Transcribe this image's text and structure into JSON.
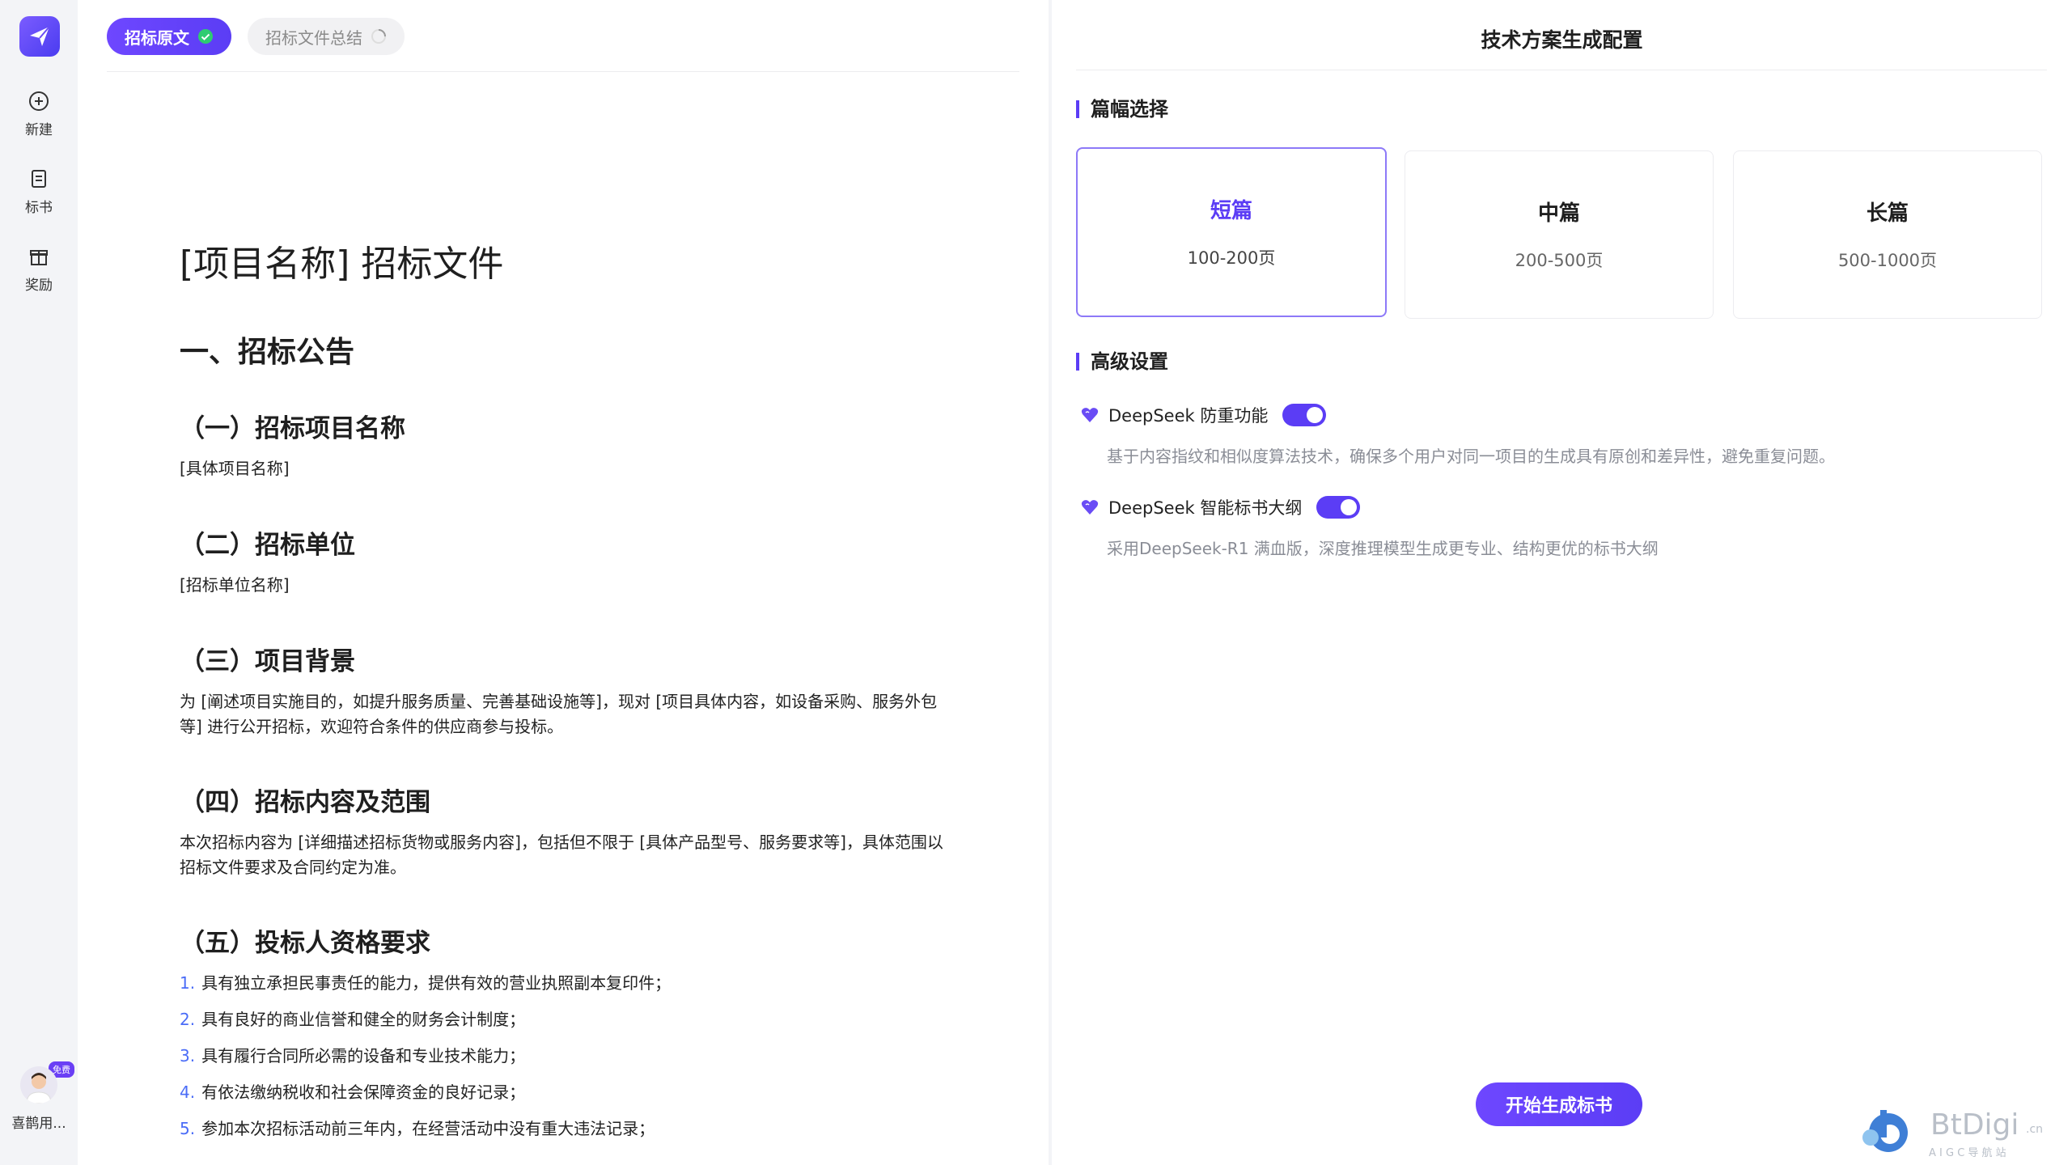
{
  "sidebar": {
    "items": [
      {
        "label": "新建",
        "icon": "plus-circle-icon"
      },
      {
        "label": "标书",
        "icon": "document-icon"
      },
      {
        "label": "奖励",
        "icon": "gift-icon"
      }
    ],
    "user": {
      "badge": "免费",
      "name": "喜鹊用..."
    }
  },
  "tabs": [
    {
      "label": "招标原文",
      "status": "done"
    },
    {
      "label": "招标文件总结",
      "status": "loading"
    }
  ],
  "document": {
    "title": "[项目名称] 招标文件",
    "section1": "一、招标公告",
    "s1": {
      "heading": "（一）招标项目名称",
      "body": "[具体项目名称]"
    },
    "s2": {
      "heading": "（二）招标单位",
      "body": "[招标单位名称]"
    },
    "s3": {
      "heading": "（三）项目背景",
      "body": "为 [阐述项目实施目的，如提升服务质量、完善基础设施等]，现对 [项目具体内容，如设备采购、服务外包等] 进行公开招标，欢迎符合条件的供应商参与投标。"
    },
    "s4": {
      "heading": "（四）招标内容及范围",
      "body": "本次招标内容为 [详细描述招标货物或服务内容]，包括但不限于 [具体产品型号、服务要求等]，具体范围以招标文件要求及合同约定为准。"
    },
    "s5": {
      "heading": "（五）投标人资格要求",
      "items": [
        {
          "num": "1.",
          "text": "具有独立承担民事责任的能力，提供有效的营业执照副本复印件；"
        },
        {
          "num": "2.",
          "text": "具有良好的商业信誉和健全的财务会计制度；"
        },
        {
          "num": "3.",
          "text": "具有履行合同所必需的设备和专业技术能力；"
        },
        {
          "num": "4.",
          "text": "有依法缴纳税收和社会保障资金的良好记录；"
        },
        {
          "num": "5.",
          "text": "参加本次招标活动前三年内，在经营活动中没有重大违法记录；"
        }
      ]
    }
  },
  "config": {
    "title": "技术方案生成配置",
    "length_section": "篇幅选择",
    "lengths": [
      {
        "title": "短篇",
        "range": "100-200页",
        "selected": true
      },
      {
        "title": "中篇",
        "range": "200-500页",
        "selected": false
      },
      {
        "title": "长篇",
        "range": "500-1000页",
        "selected": false
      }
    ],
    "advanced_section": "高级设置",
    "features": [
      {
        "name": "DeepSeek 防重功能",
        "enabled": true,
        "desc": "基于内容指纹和相似度算法技术，确保多个用户对同一项目的生成具有原创和差异性，避免重复问题。"
      },
      {
        "name": "DeepSeek 智能标书大纲",
        "enabled": true,
        "desc": "采用DeepSeek-R1 满血版，深度推理模型生成更专业、结构更优的标书大纲"
      }
    ],
    "generate_button": "开始生成标书"
  },
  "watermark": {
    "brand": "BtDigi",
    "suffix": ".cn",
    "sub": "A I G C 导 航 站"
  },
  "colors": {
    "accent": "#5b3df5",
    "link_number": "#4a6cf7"
  }
}
